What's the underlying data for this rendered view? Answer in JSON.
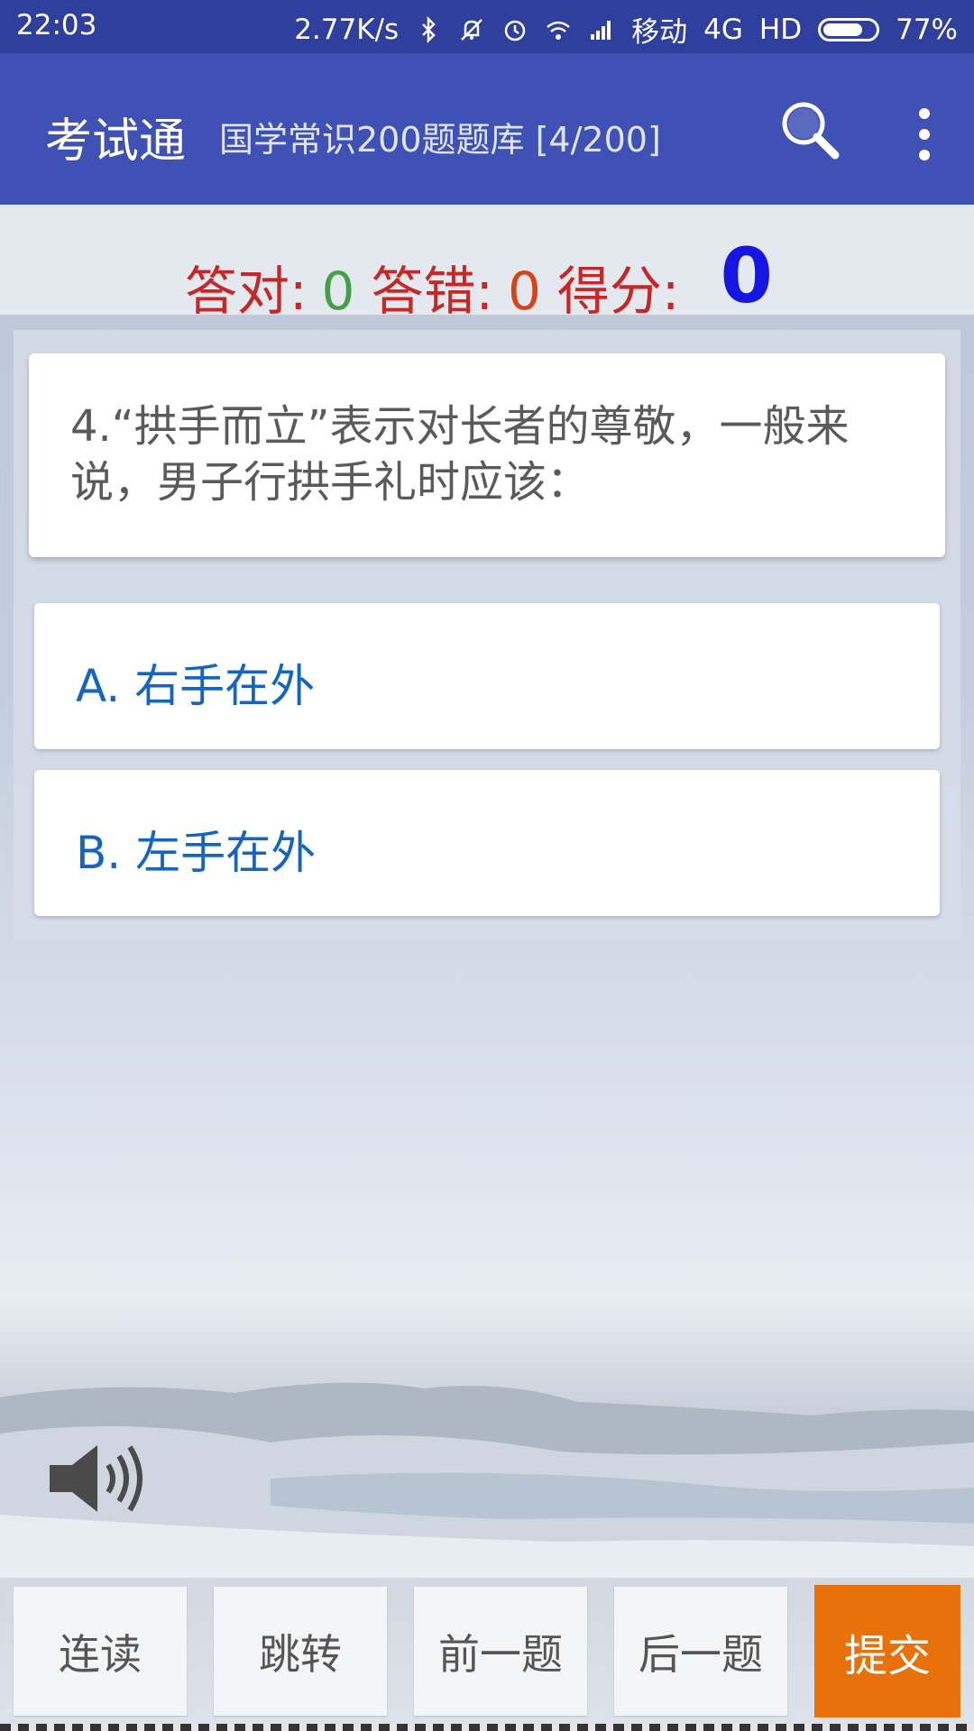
{
  "status_bar": {
    "time": "22:03",
    "net_speed": "2.77K/s",
    "carrier": "移动",
    "network": "4G",
    "hd": "HD",
    "battery": "77%",
    "battery_level": 0.77,
    "icons": [
      "bluetooth-icon",
      "bell-off-icon",
      "alarm-icon",
      "wifi-icon",
      "signal-icon",
      "battery-icon"
    ]
  },
  "app_bar": {
    "title": "考试通",
    "subtitle": "国学常识200题题库 [4/200]",
    "icons": [
      "search-icon",
      "more-vert-icon"
    ]
  },
  "score": {
    "correct_label": "答对:",
    "correct_value": "0",
    "wrong_label": "答错:",
    "wrong_value": "0",
    "score_label": "得分:",
    "score_value": "0"
  },
  "question": {
    "text": "4.“拱手而立”表示对长者的尊敬，一般来说，男子行拱手礼时应该：",
    "options": [
      {
        "label": "A. 右手在外"
      },
      {
        "label": "B. 左手在外"
      }
    ]
  },
  "bottom_bar": {
    "read_all": "连读",
    "jump": "跳转",
    "prev": "前一题",
    "next": "后一题",
    "submit": "提交"
  },
  "colors": {
    "status_bar": "#2f3f9e",
    "app_bar": "#3f51b5",
    "label_red": "#c62828",
    "correct_green": "#43a047",
    "wrong_red": "#d84315",
    "score_blue": "#1515e6",
    "option_blue": "#1565c0",
    "submit_orange": "#e8710a"
  }
}
